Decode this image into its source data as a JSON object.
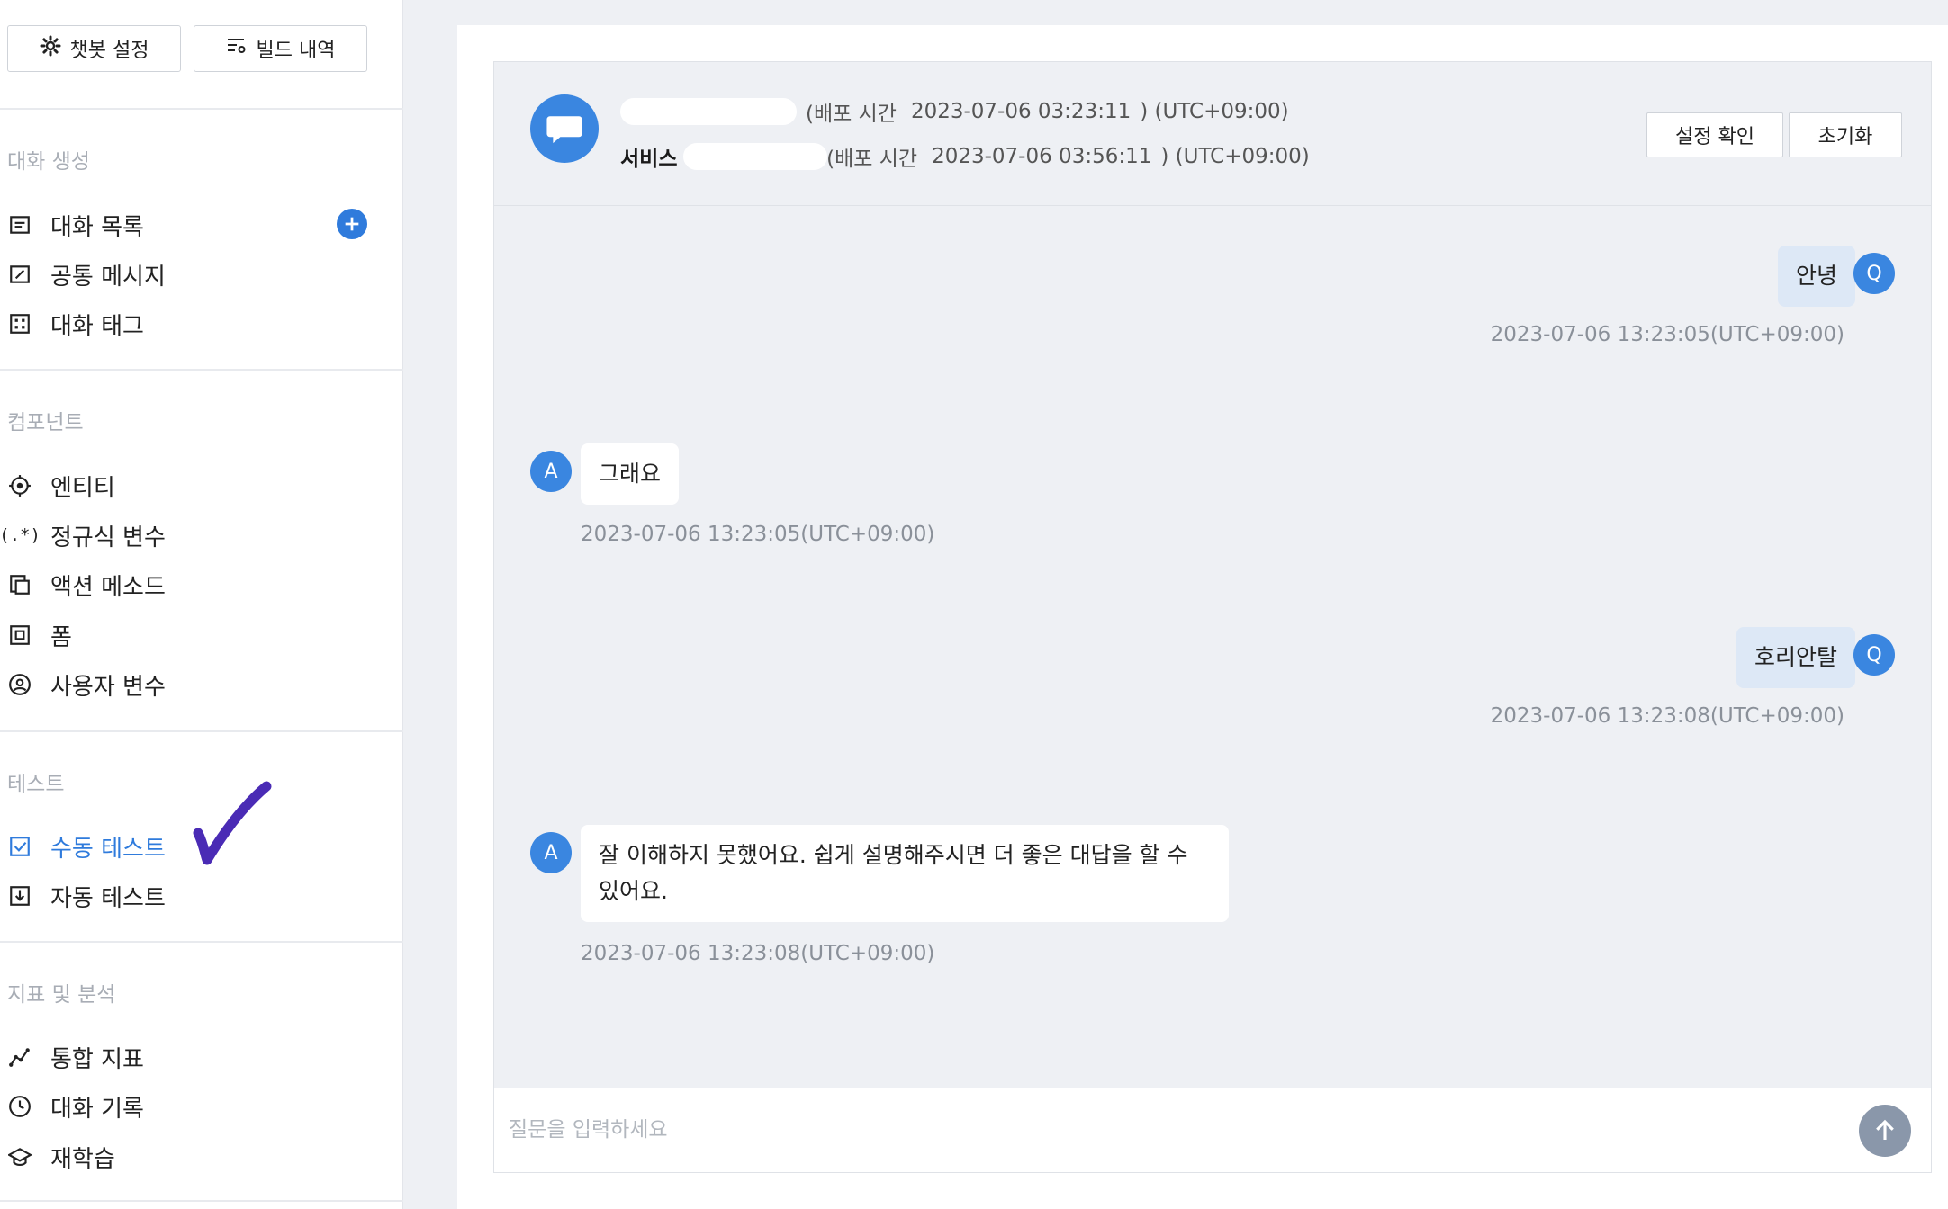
{
  "sidebar": {
    "chatbot_settings_label": "챗봇 설정",
    "build_history_label": "빌드 내역",
    "sections": {
      "conversation": "대화 생성",
      "components": "컴포넌트",
      "test": "테스트",
      "analytics": "지표 및 분석"
    },
    "items": {
      "conversation_list": "대화 목록",
      "common_message": "공통 메시지",
      "conversation_tag": "대화 태그",
      "entity": "엔티티",
      "regex_variable": "정규식 변수",
      "action_method": "액션 메소드",
      "form": "폼",
      "user_variable": "사용자 변수",
      "manual_test": "수동 테스트",
      "auto_test": "자동 테스트",
      "integrated_metrics": "통합 지표",
      "conversation_log": "대화 기록",
      "relearning": "재학습"
    },
    "regex_icon_text": "(.*)"
  },
  "header": {
    "line1_prefix": "(배포 시간",
    "line1_time": "2023-07-06 03:23:11",
    "line1_suffix": ") (UTC+09:00)",
    "line2_name": "서비스 ID",
    "line2_prefix": "(배포 시간",
    "line2_time": "2023-07-06 03:56:11",
    "line2_suffix": ") (UTC+09:00)",
    "confirm_settings": "설정 확인",
    "reset": "초기화"
  },
  "messages": [
    {
      "role": "user",
      "avatar": "Q",
      "text": "안녕",
      "time": "2023-07-06 13:23:05(UTC+09:00)"
    },
    {
      "role": "bot",
      "avatar": "A",
      "text": "그래요",
      "time": "2023-07-06 13:23:05(UTC+09:00)"
    },
    {
      "role": "user",
      "avatar": "Q",
      "text": "호리안탈",
      "time": "2023-07-06 13:23:08(UTC+09:00)"
    },
    {
      "role": "bot",
      "avatar": "A",
      "text": "잘 이해하지 못했어요. 쉽게 설명해주시면 더 좋은 대답을 할 수 있어요.",
      "time": "2023-07-06 13:23:08(UTC+09:00)"
    }
  ],
  "input": {
    "placeholder": "질문을 입력하세요",
    "value": ""
  },
  "colors": {
    "accent": "#2f7bdc",
    "avatar": "#3a86e0",
    "send_button": "#8a97aa",
    "check_mark": "#4a2bb5"
  }
}
